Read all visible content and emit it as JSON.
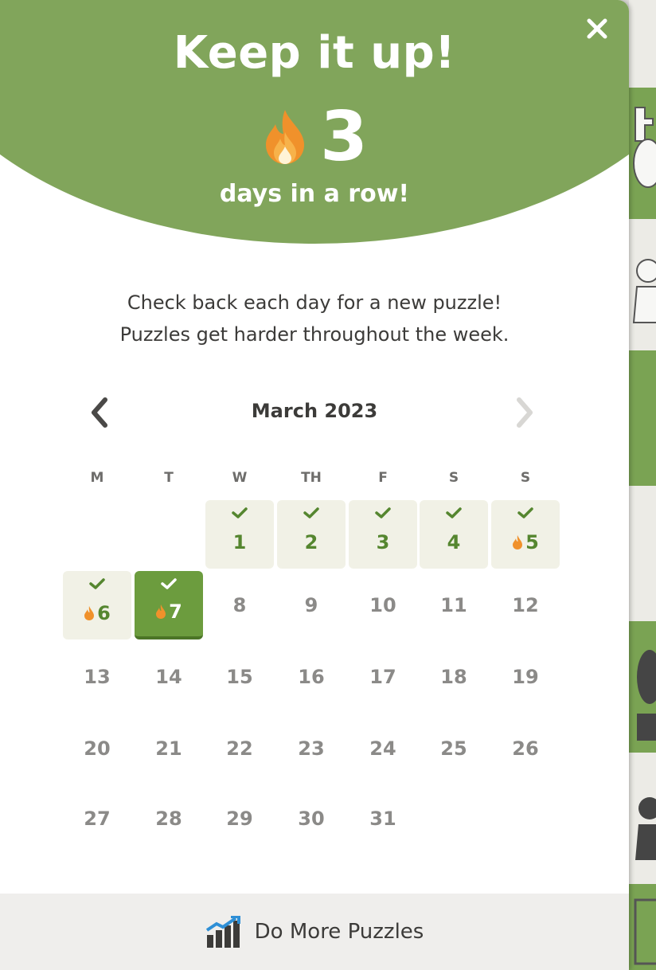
{
  "header": {
    "title": "Keep it up!",
    "streak_count": "3",
    "streak_label": "days in a row!",
    "close_icon": "close-icon",
    "flame_icon": "flame-icon"
  },
  "info": {
    "line1": "Check back each day for a new puzzle!",
    "line2": "Puzzles get harder throughout the week."
  },
  "calendar": {
    "month_label": "March 2023",
    "prev_icon": "chevron-left-icon",
    "next_icon": "chevron-right-icon",
    "weekdays": [
      "M",
      "T",
      "W",
      "TH",
      "F",
      "S",
      "S"
    ],
    "weeks": [
      [
        {
          "day": ""
        },
        {
          "day": ""
        },
        {
          "day": "1",
          "status": "done"
        },
        {
          "day": "2",
          "status": "done"
        },
        {
          "day": "3",
          "status": "done"
        },
        {
          "day": "4",
          "status": "done"
        },
        {
          "day": "5",
          "status": "done",
          "streak": true
        }
      ],
      [
        {
          "day": "6",
          "status": "done",
          "streak": true
        },
        {
          "day": "7",
          "status": "today",
          "streak": true
        },
        {
          "day": "8"
        },
        {
          "day": "9"
        },
        {
          "day": "10"
        },
        {
          "day": "11"
        },
        {
          "day": "12"
        }
      ],
      [
        {
          "day": "13"
        },
        {
          "day": "14"
        },
        {
          "day": "15"
        },
        {
          "day": "16"
        },
        {
          "day": "17"
        },
        {
          "day": "18"
        },
        {
          "day": "19"
        }
      ],
      [
        {
          "day": "20"
        },
        {
          "day": "21"
        },
        {
          "day": "22"
        },
        {
          "day": "23"
        },
        {
          "day": "24"
        },
        {
          "day": "25"
        },
        {
          "day": "26"
        }
      ],
      [
        {
          "day": "27"
        },
        {
          "day": "28"
        },
        {
          "day": "29"
        },
        {
          "day": "30"
        },
        {
          "day": "31"
        },
        {
          "day": ""
        },
        {
          "day": ""
        }
      ]
    ]
  },
  "footer": {
    "label": "Do More Puzzles",
    "icon": "chart-bars-icon"
  },
  "colors": {
    "banner_green": "#81a55b",
    "today_green": "#6c9c3e",
    "done_bg": "#f1f1e6",
    "check_green": "#55862f",
    "flame_orange": "#f0912b"
  }
}
